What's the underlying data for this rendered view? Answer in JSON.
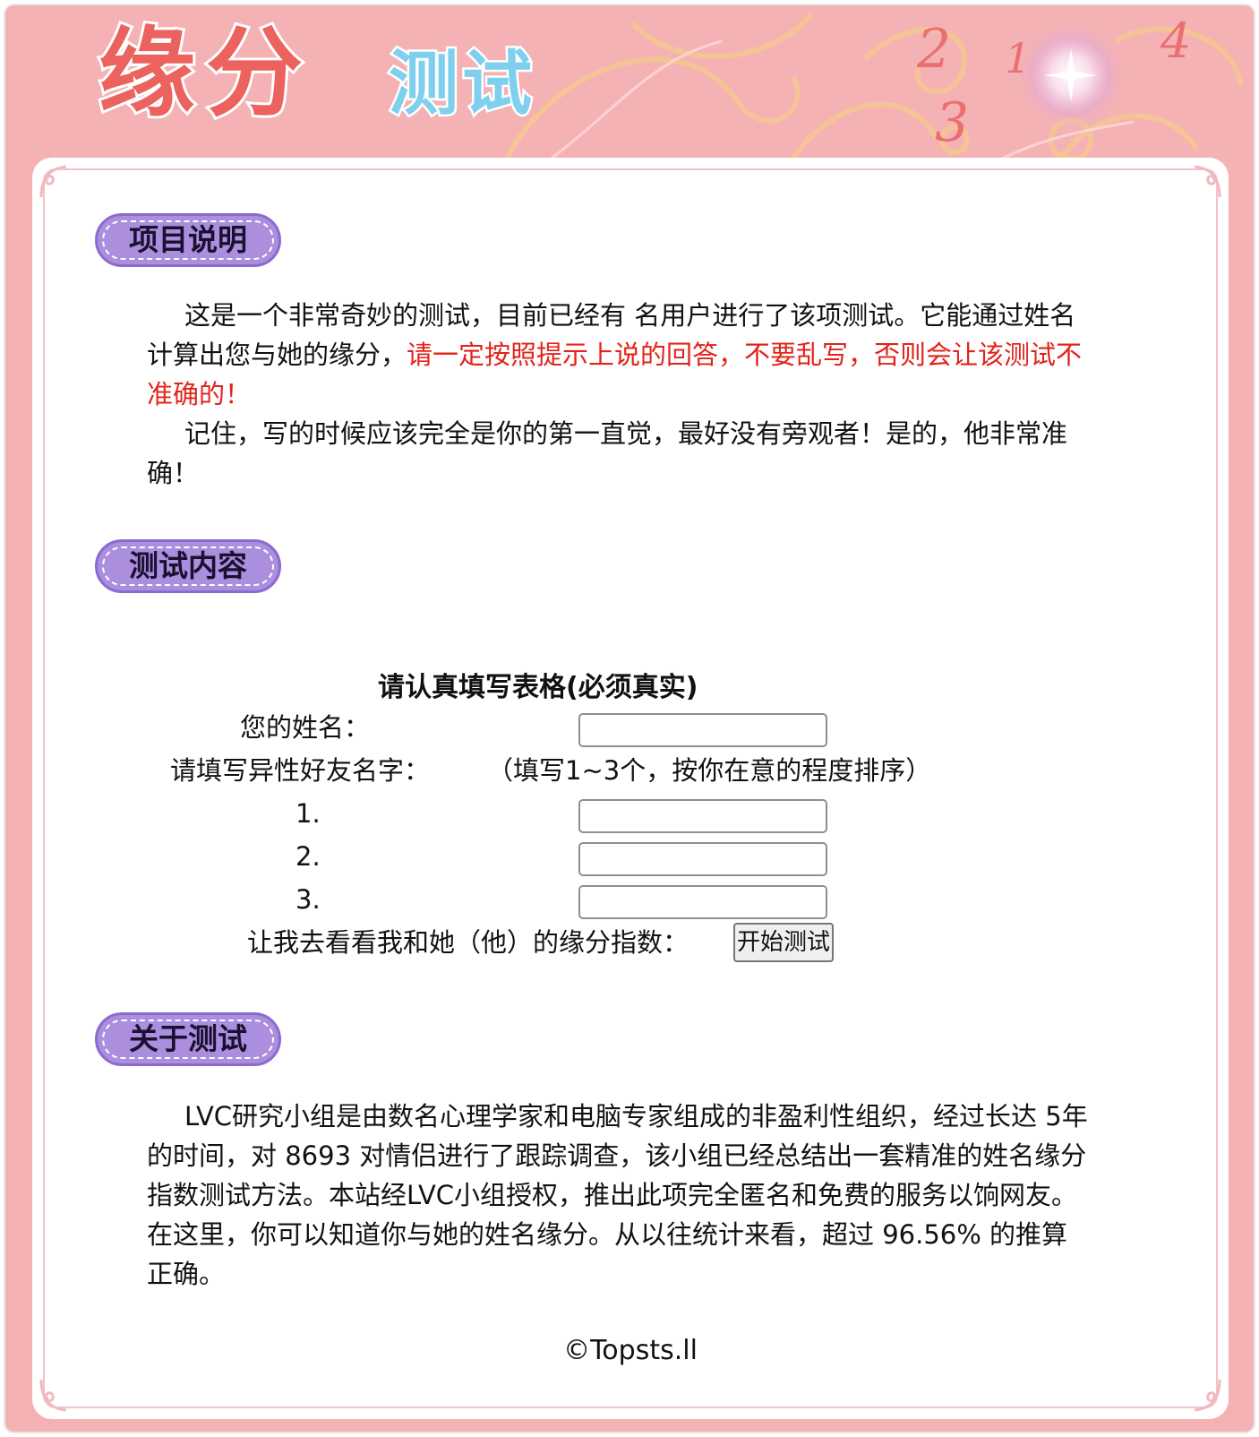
{
  "header": {
    "title_main": "缘分",
    "title_sub": "测试",
    "deco_numbers": [
      "2",
      "1",
      "4",
      "3"
    ]
  },
  "intro": {
    "heading": "项目说明",
    "p1_normal": "这是一个非常奇妙的测试，目前已经有 名用户进行了该项测试。它能通过姓名计算出您与她的缘分，",
    "p1_red": "请一定按照提示上说的回答，不要乱写，否则会让该测试不准确的！",
    "p2": "记住，写的时候应该完全是你的第一直觉，最好没有旁观者！是的，他非常准确！"
  },
  "test": {
    "heading": "测试内容",
    "form_title": "请认真填写表格(必须真实)",
    "name_label": "您的姓名：",
    "friends_label": "请填写异性好友名字：",
    "friends_hint": "（填写1~3个，按你在意的程度排序）",
    "friend_nums": [
      "1.",
      "2.",
      "3."
    ],
    "name_value": "",
    "friend_values": [
      "",
      "",
      ""
    ],
    "submit_prompt": "让我去看看我和她（他）的缘分指数：",
    "submit_label": "开始测试"
  },
  "about": {
    "heading": "关于测试",
    "text": "LVC研究小组是由数名心理学家和电脑专家组成的非盈利性组织，经过长达 5年的时间，对 8693 对情侣进行了跟踪调查，该小组已经总结出一套精准的姓名缘分指数测试方法。本站经LVC小组授权，推出此项完全匿名和免费的服务以饷网友。在这里，你可以知道你与她的姓名缘分。从以往统计来看，超过 96.56% 的推算正确。"
  },
  "footer": {
    "text": "©Topsts.ll"
  },
  "colors": {
    "background_pink": "#f4b2b4",
    "title_red": "#ec625e",
    "title_blue": "#7fd0ee",
    "tag_purple": "#ab8edd",
    "alert_red": "#e2231a"
  }
}
